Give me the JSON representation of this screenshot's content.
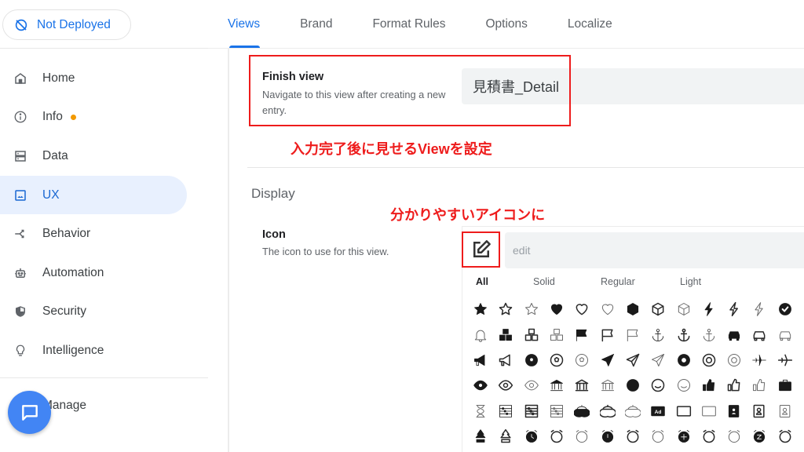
{
  "deploy_status": {
    "label": "Not Deployed",
    "icon": "not-deployed-icon"
  },
  "sidebar": {
    "items": [
      {
        "label": "Home",
        "icon": "home-icon"
      },
      {
        "label": "Info",
        "icon": "info-icon",
        "badge": "dot"
      },
      {
        "label": "Data",
        "icon": "data-icon"
      },
      {
        "label": "UX",
        "icon": "ux-icon",
        "active": true
      },
      {
        "label": "Behavior",
        "icon": "behavior-icon"
      },
      {
        "label": "Automation",
        "icon": "automation-icon"
      },
      {
        "label": "Security",
        "icon": "security-icon"
      },
      {
        "label": "Intelligence",
        "icon": "intelligence-icon"
      }
    ],
    "manage_label": "Manage",
    "fab_icon": "chat-icon"
  },
  "tabs": [
    {
      "label": "Views",
      "active": true
    },
    {
      "label": "Brand"
    },
    {
      "label": "Format Rules"
    },
    {
      "label": "Options"
    },
    {
      "label": "Localize"
    }
  ],
  "finish_view": {
    "label": "Finish view",
    "description": "Navigate to this view after creating a new entry.",
    "value": "見積書_Detail"
  },
  "annotations": {
    "finish_view_note": "入力完了後に見せるViewを設定",
    "icon_note": "分かりやすいアイコンに"
  },
  "display": {
    "heading": "Display",
    "icon_label": "Icon",
    "icon_description": "The icon to use for this view.",
    "selected_icon": "edit-icon",
    "search_placeholder": "edit",
    "filter_tabs": [
      {
        "label": "All",
        "active": true
      },
      {
        "label": "Solid"
      },
      {
        "label": "Regular"
      },
      {
        "label": "Light"
      }
    ],
    "icon_grid": [
      [
        "star-solid",
        "star-regular",
        "star-light",
        "heart-solid",
        "heart-regular",
        "heart-light",
        "cube-solid",
        "cube-regular",
        "cube-light",
        "bolt-solid",
        "bolt-regular",
        "bolt-light",
        "check-circle-solid"
      ],
      [
        "bell-light",
        "cubes-solid",
        "cubes-regular",
        "cubes-light",
        "flag-solid",
        "flag-regular",
        "flag-light",
        "anchor-solid",
        "anchor-regular",
        "anchor-light",
        "car-solid",
        "car-regular",
        "car-light"
      ],
      [
        "megaphone-solid",
        "megaphone-regular",
        "futbol-solid",
        "futbol-regular",
        "futbol-light",
        "paper-plane-solid",
        "paper-plane-regular",
        "paper-plane-light",
        "life-ring-solid",
        "life-ring-regular",
        "life-ring-light",
        "plane-solid",
        "plane-regular"
      ],
      [
        "eye-solid",
        "eye-regular",
        "eye-light",
        "university-solid",
        "university-regular",
        "university-light",
        "smile-solid",
        "smile-regular",
        "smile-light",
        "thumbs-up-solid",
        "thumbs-up-regular",
        "thumbs-up-light",
        "suitcase-solid"
      ],
      [
        "hourglass-light",
        "abacus-solid",
        "abacus-regular",
        "abacus-light",
        "acorn-solid",
        "acorn-regular",
        "acorn-light",
        "ad-solid",
        "ad-regular",
        "ad-light",
        "address-book-solid",
        "address-book-regular",
        "address-book-light"
      ],
      [
        "tree-solid",
        "tree-regular",
        "alarm-clock-solid",
        "alarm-clock-regular",
        "alarm-clock-light",
        "alarm-exclamation-solid",
        "alarm-exclamation-regular",
        "alarm-exclamation-light",
        "alarm-plus-solid",
        "alarm-plus-regular",
        "alarm-plus-light",
        "alarm-snooze-solid",
        "alarm-snooze-regular"
      ]
    ]
  },
  "colors": {
    "accent": "#1a73e8",
    "annotation_red": "#ee1c1c",
    "active_nav_bg": "#e8f0fe",
    "info_dot": "#f29900",
    "fab": "#4285f4"
  }
}
